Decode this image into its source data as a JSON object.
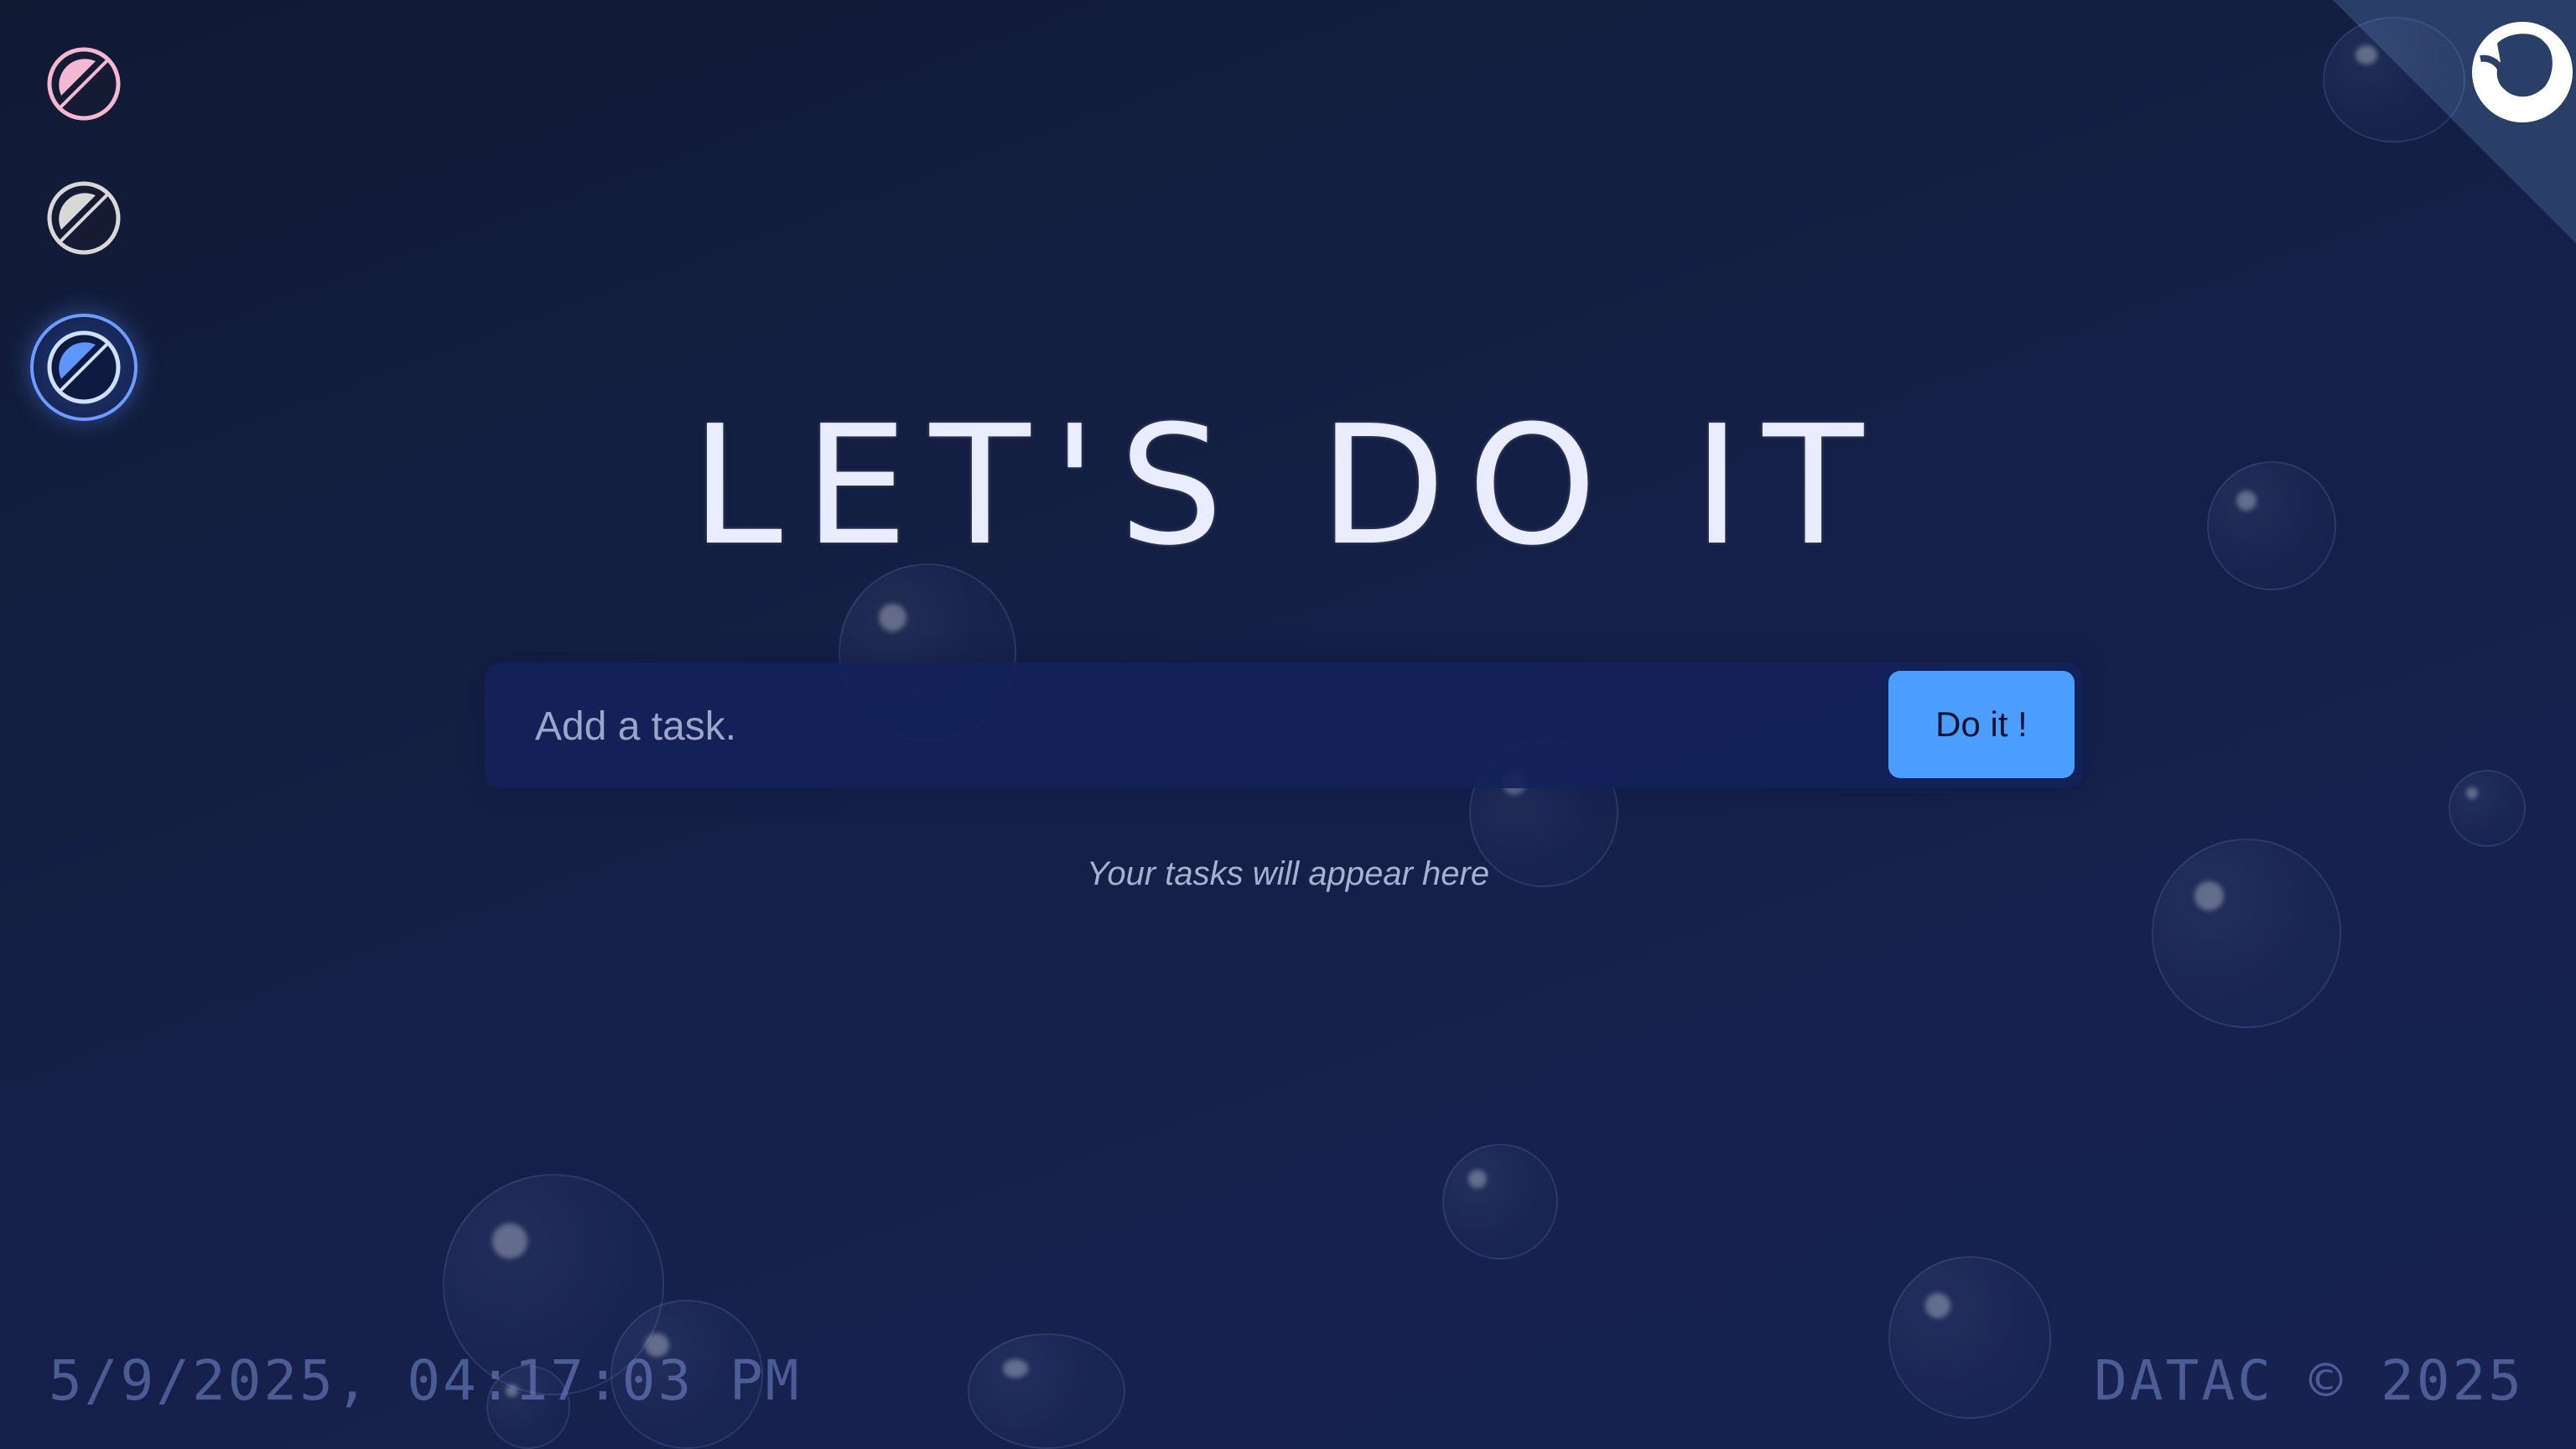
{
  "theme_switcher": {
    "options": [
      {
        "name": "pink",
        "color": "#f5b8d2"
      },
      {
        "name": "gray",
        "color": "#d8d8d8"
      },
      {
        "name": "blue",
        "color": "#5f95ff",
        "selected": true
      }
    ]
  },
  "corner": {
    "icon": "github-octocat-icon",
    "background": "#2a3f68"
  },
  "header": {
    "title": "LET'S DO IT"
  },
  "task_form": {
    "placeholder": "Add a task.",
    "value": "",
    "submit_label": "Do it !",
    "submit_color": "#4b9dff"
  },
  "tasks": {
    "empty_message": "Your tasks will appear here"
  },
  "footer": {
    "datetime": "5/9/2025, 04:17:03 PM",
    "copyright": "DATAC © 2025"
  },
  "colors": {
    "background": "#141f45",
    "accent": "#4b9dff",
    "title_text": "#e9edff"
  }
}
